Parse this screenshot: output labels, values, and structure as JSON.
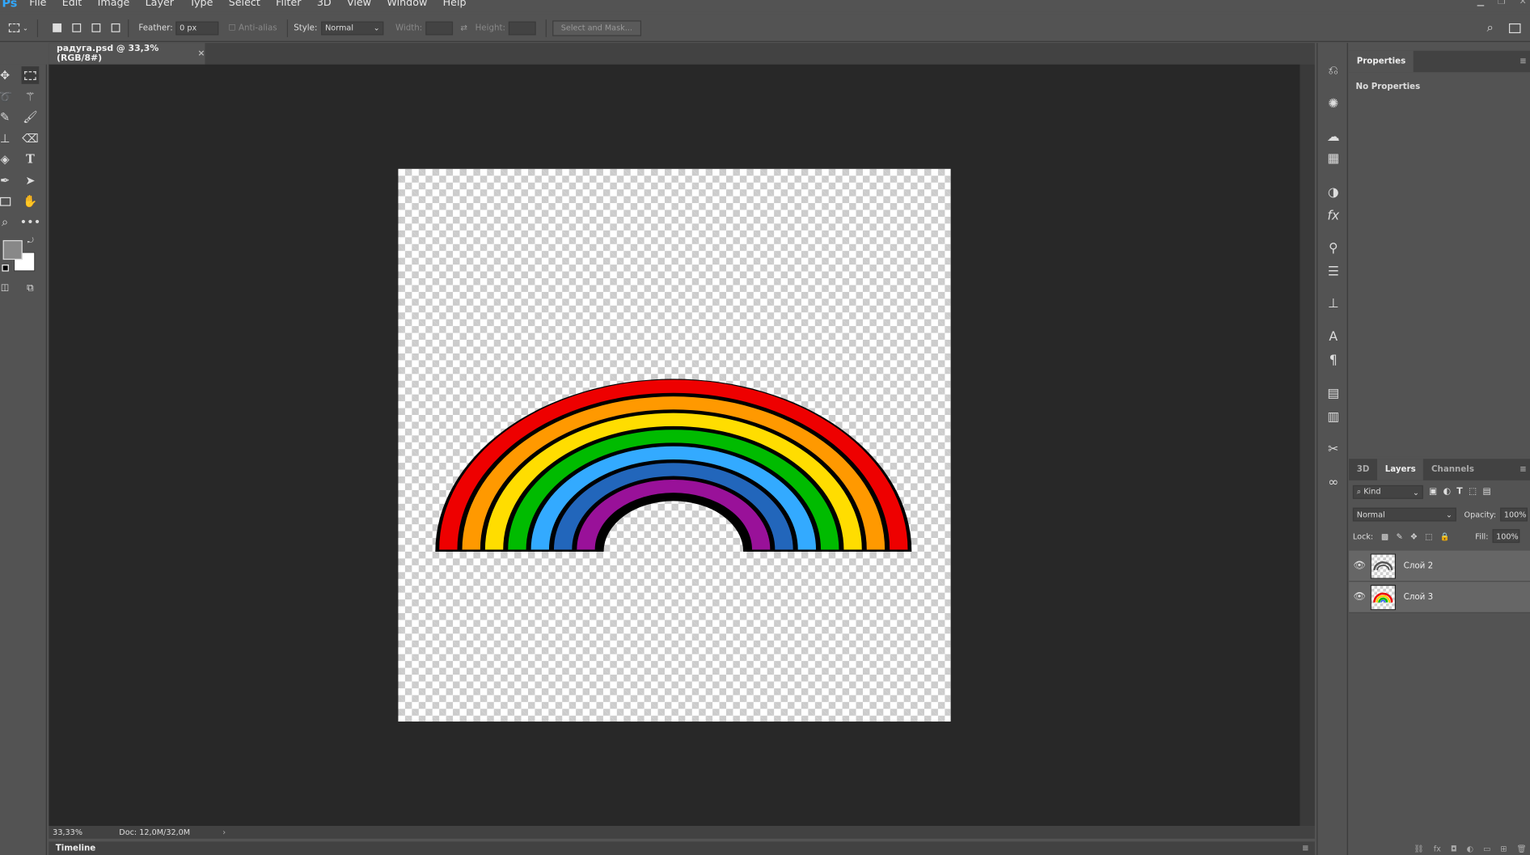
{
  "menu": {
    "logo": "Ps",
    "items": [
      "File",
      "Edit",
      "Image",
      "Layer",
      "Type",
      "Select",
      "Filter",
      "3D",
      "View",
      "Window",
      "Help"
    ]
  },
  "options": {
    "feather_label": "Feather:",
    "feather_value": "0 px",
    "antialias": "Anti-alias",
    "style_label": "Style:",
    "style_value": "Normal",
    "width_label": "Width:",
    "height_label": "Height:",
    "select_mask": "Select and Mask..."
  },
  "doc_tab": {
    "title": "радуга.psd @ 33,3% (RGB/8#)",
    "close": "×"
  },
  "status": {
    "zoom": "33,33%",
    "doc": "Doc: 12,0M/32,0M",
    "arrow": "›"
  },
  "timeline": {
    "label": "Timeline"
  },
  "properties": {
    "tab": "Properties",
    "empty": "No Properties"
  },
  "layers_panel": {
    "tabs": [
      "3D",
      "Layers",
      "Channels"
    ],
    "kind": "Kind",
    "blend": "Normal",
    "opacity_label": "Opacity:",
    "opacity": "100%",
    "lock_label": "Lock:",
    "fill_label": "Fill:",
    "fill": "100%",
    "layers": [
      {
        "name": "Слой 2"
      },
      {
        "name": "Слой 3"
      }
    ]
  },
  "colors": {
    "rainbow": [
      "#ee0000",
      "#ff9900",
      "#ffdd00",
      "#00bb00",
      "#33aaff",
      "#2266bb",
      "#991199"
    ]
  }
}
